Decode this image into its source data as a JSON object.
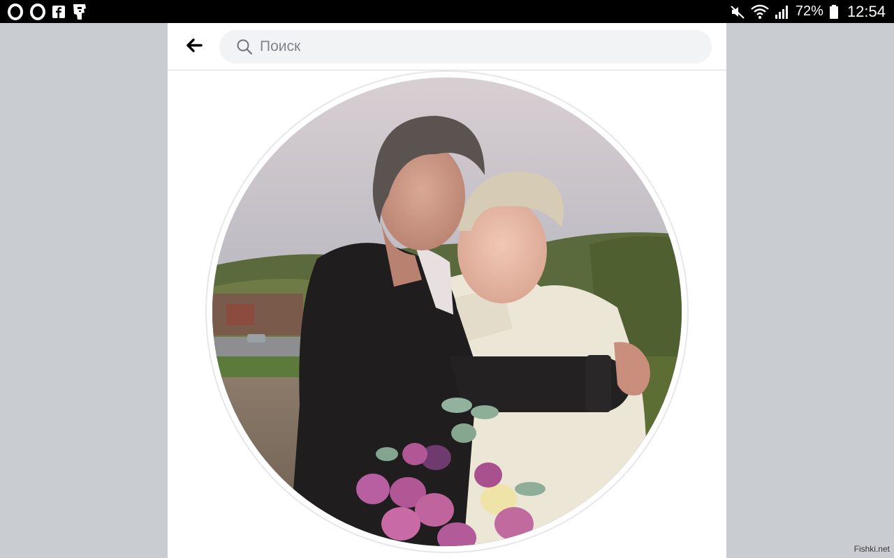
{
  "status_bar": {
    "left_icons": [
      "opera-icon",
      "opera-icon",
      "facebook-icon",
      "app-icon"
    ],
    "battery_percent": "72%",
    "time": "12:54"
  },
  "header": {
    "search_placeholder": "Поиск"
  },
  "watermark": "Fishki.net",
  "colors": {
    "page_background": "#c9ccd1",
    "panel_background": "#ffffff",
    "search_background": "#f2f3f5",
    "status_bar": "#000000"
  }
}
